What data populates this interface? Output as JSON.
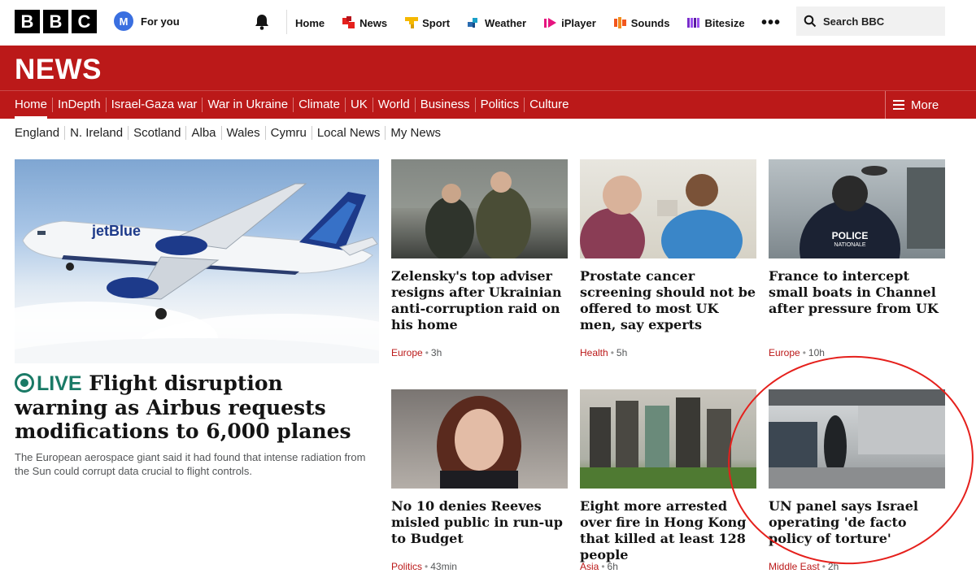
{
  "topbar": {
    "logo_letters": [
      "B",
      "B",
      "C"
    ],
    "avatar_letter": "M",
    "for_you": "For you",
    "nav": [
      {
        "label": "Home",
        "icon": null
      },
      {
        "label": "News",
        "icon": "news-icon",
        "color": "#e5201c"
      },
      {
        "label": "Sport",
        "icon": "sport-icon",
        "color": "#f5b800"
      },
      {
        "label": "Weather",
        "icon": "weather-icon",
        "color": "#2a6bb0"
      },
      {
        "label": "iPlayer",
        "icon": "iplayer-icon",
        "color": "#e6147f"
      },
      {
        "label": "Sounds",
        "icon": "sounds-icon",
        "color": "#f2561d"
      },
      {
        "label": "Bitesize",
        "icon": "bitesize-icon",
        "color": "#7a2dcc"
      }
    ],
    "more": "•••",
    "search_label": "Search BBC"
  },
  "news": {
    "title": "NEWS",
    "brand_color": "#bb1919",
    "sections": [
      "Home",
      "InDepth",
      "Israel-Gaza war",
      "War in Ukraine",
      "Climate",
      "UK",
      "World",
      "Business",
      "Politics",
      "Culture"
    ],
    "active_section": "Home",
    "more_label": "More",
    "regions": [
      "England",
      "N. Ireland",
      "Scotland",
      "Alba",
      "Wales",
      "Cymru",
      "Local News",
      "My News"
    ]
  },
  "lead": {
    "live_label": "LIVE",
    "headline": "Flight disruption warning as Airbus requests modifications to 6,000 planes",
    "summary": "The European aerospace giant said it had found that intense radiation from the Sun could corrupt data crucial to flight controls.",
    "airline_text": "jetBlue"
  },
  "stories": [
    {
      "title": "Zelensky's top adviser resigns after Ukrainian anti-corruption raid on his home",
      "tag": "Europe",
      "time": "3h"
    },
    {
      "title": "Prostate cancer screening should not be offered to most UK men, say experts",
      "tag": "Health",
      "time": "5h"
    },
    {
      "title": "France to intercept small boats in Channel after pressure from UK",
      "tag": "Europe",
      "time": "10h",
      "image_text": "POLICE\nNATIONALE"
    },
    {
      "title": "No 10 denies Reeves misled public in run-up to Budget",
      "tag": "Politics",
      "time": "43min"
    },
    {
      "title": "Eight more arrested over fire in Hong Kong that killed at least 128 people",
      "tag": "Asia",
      "time": "6h"
    },
    {
      "title": "UN panel says Israel operating 'de facto policy of torture'",
      "tag": "Middle East",
      "time": "2h"
    }
  ]
}
